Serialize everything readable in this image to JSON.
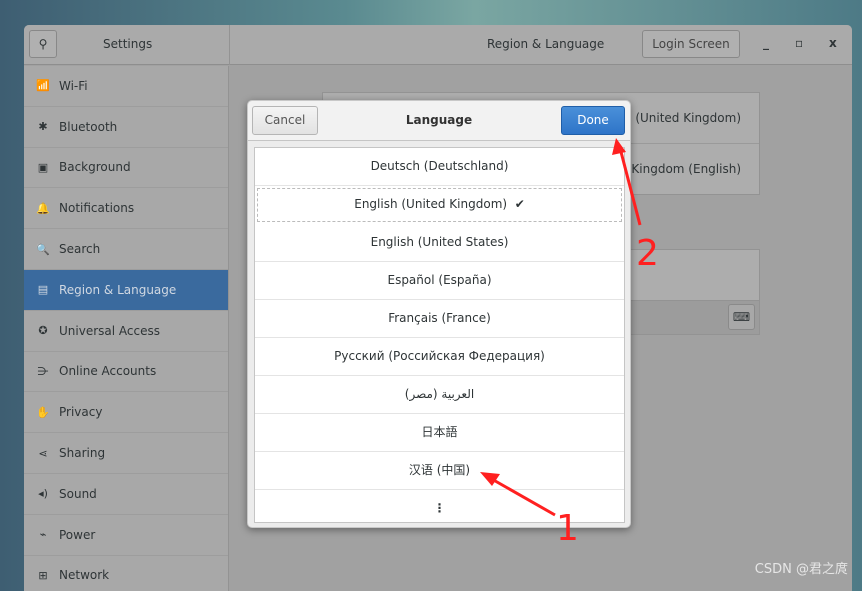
{
  "header": {
    "app_title": "Settings",
    "page_title": "Region & Language",
    "login_screen_label": "Login Screen",
    "minimize": "_",
    "maximize": "▫",
    "close": "x"
  },
  "sidebar": {
    "items": [
      {
        "label": "Wi-Fi",
        "icon": "📶"
      },
      {
        "label": "Bluetooth",
        "icon": "✱"
      },
      {
        "label": "Background",
        "icon": "▣"
      },
      {
        "label": "Notifications",
        "icon": "🔔"
      },
      {
        "label": "Search",
        "icon": "🔍"
      },
      {
        "label": "Region & Language",
        "icon": "▤"
      },
      {
        "label": "Universal Access",
        "icon": "✪"
      },
      {
        "label": "Online Accounts",
        "icon": "⋺"
      },
      {
        "label": "Privacy",
        "icon": "✋"
      },
      {
        "label": "Sharing",
        "icon": "⋖"
      },
      {
        "label": "Sound",
        "icon": "◂)"
      },
      {
        "label": "Power",
        "icon": "⌁"
      },
      {
        "label": "Network",
        "icon": "⊞"
      }
    ],
    "selected": "Region & Language"
  },
  "panel": {
    "language_value": "English (United Kingdom)",
    "formats_value": "United Kingdom (English)"
  },
  "dialog": {
    "title": "Language",
    "cancel_label": "Cancel",
    "done_label": "Done",
    "languages": [
      "Deutsch (Deutschland)",
      "English (United Kingdom)",
      "English (United States)",
      "Español (España)",
      "Français (France)",
      "Русский (Российская Федерация)",
      "العربية (مصر)",
      "日本語",
      "汉语 (中国)"
    ],
    "selected": "English (United Kingdom)",
    "check": "✔",
    "more": "⋮"
  },
  "annotations": {
    "step1": "1",
    "step2": "2",
    "color": "#ff2020"
  },
  "watermark": "CSDN @君之庹"
}
